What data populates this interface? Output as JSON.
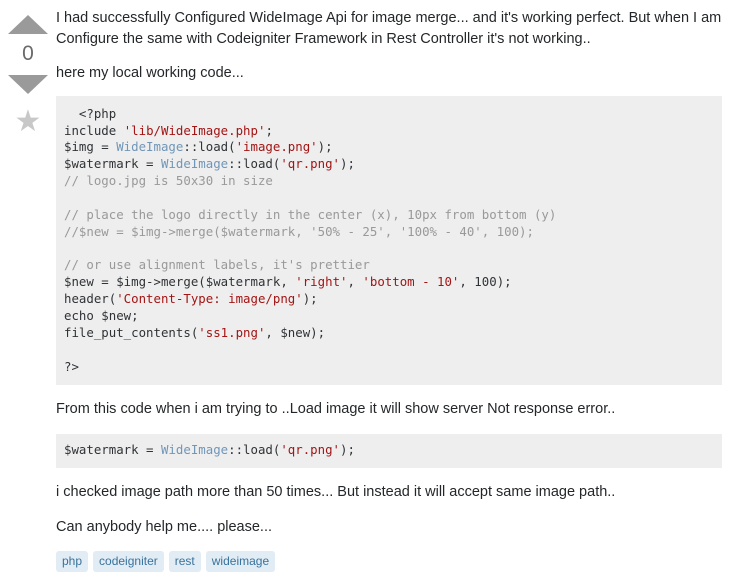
{
  "vote": {
    "up_icon": "triangle-up-icon",
    "down_icon": "triangle-down-icon",
    "count": "0",
    "favorite_icon": "star-icon",
    "star_glyph": "★"
  },
  "post": {
    "paragraphs": {
      "intro": "I had successfully Configured WideImage Api for image merge... and it's working perfect. But when I am Configure the same with Codeigniter Framework in Rest Controller it's not working..",
      "here_code": "here my local working code...",
      "from_this_code": "From this code when i am trying to ..Load image it will show server Not response error..",
      "checked_path": "i checked image path more than 50 times... But instead it will accept same image path..",
      "help": "Can anybody help me.... please..."
    },
    "code_block_1": {
      "lines": [
        [
          {
            "t": "  <?php",
            "c": "s-pln"
          }
        ],
        [
          {
            "t": "include ",
            "c": "s-pln"
          },
          {
            "t": "'lib/WideImage.php'",
            "c": "s-str"
          },
          {
            "t": ";",
            "c": "s-pln"
          }
        ],
        [
          {
            "t": "$img = ",
            "c": "s-pln"
          },
          {
            "t": "WideImage",
            "c": "s-cls"
          },
          {
            "t": "::load(",
            "c": "s-pln"
          },
          {
            "t": "'image.png'",
            "c": "s-str"
          },
          {
            "t": ");",
            "c": "s-pln"
          }
        ],
        [
          {
            "t": "$watermark = ",
            "c": "s-pln"
          },
          {
            "t": "WideImage",
            "c": "s-cls"
          },
          {
            "t": "::load(",
            "c": "s-pln"
          },
          {
            "t": "'qr.png'",
            "c": "s-str"
          },
          {
            "t": ");",
            "c": "s-pln"
          }
        ],
        [
          {
            "t": "// logo.jpg is 50x30 in size",
            "c": "s-com"
          }
        ],
        [
          {
            "t": "",
            "c": "s-pln"
          }
        ],
        [
          {
            "t": "// place the logo directly in the center (x), 10px from bottom (y)",
            "c": "s-com"
          }
        ],
        [
          {
            "t": "//$new = $img->merge($watermark, '50% - 25', '100% - 40', 100);",
            "c": "s-com"
          }
        ],
        [
          {
            "t": "",
            "c": "s-pln"
          }
        ],
        [
          {
            "t": "// or use alignment labels, it's prettier",
            "c": "s-com"
          }
        ],
        [
          {
            "t": "$new = $img->merge($watermark, ",
            "c": "s-pln"
          },
          {
            "t": "'right'",
            "c": "s-str"
          },
          {
            "t": ", ",
            "c": "s-pln"
          },
          {
            "t": "'bottom - 10'",
            "c": "s-str"
          },
          {
            "t": ", 100);",
            "c": "s-pln"
          }
        ],
        [
          {
            "t": "header(",
            "c": "s-pln"
          },
          {
            "t": "'Content-Type: image/png'",
            "c": "s-str"
          },
          {
            "t": ");",
            "c": "s-pln"
          }
        ],
        [
          {
            "t": "echo $new;",
            "c": "s-pln"
          }
        ],
        [
          {
            "t": "file_put_contents(",
            "c": "s-pln"
          },
          {
            "t": "'ss1.png'",
            "c": "s-str"
          },
          {
            "t": ", $new);",
            "c": "s-pln"
          }
        ],
        [
          {
            "t": "",
            "c": "s-pln"
          }
        ],
        [
          {
            "t": "?>",
            "c": "s-pln"
          }
        ]
      ]
    },
    "code_block_2": {
      "lines": [
        [
          {
            "t": "$watermark = ",
            "c": "s-pln"
          },
          {
            "t": "WideImage",
            "c": "s-cls"
          },
          {
            "t": "::load(",
            "c": "s-pln"
          },
          {
            "t": "'qr.png'",
            "c": "s-str"
          },
          {
            "t": ");",
            "c": "s-pln"
          }
        ]
      ]
    },
    "tags": [
      "php",
      "codeigniter",
      "rest",
      "wideimage"
    ]
  },
  "colors": {
    "code_background": "#eeeeee",
    "string": "#a31515",
    "comment": "#999999",
    "class_name": "#7096b8",
    "tag_background": "#e1ecf4",
    "tag_text": "#39739d",
    "vote_arrow": "#9a9a9a",
    "star": "#c8c8c8",
    "body_text": "#242729"
  }
}
